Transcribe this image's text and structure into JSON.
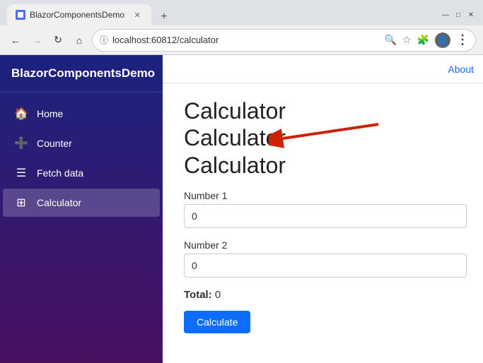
{
  "browser": {
    "tab_title": "BlazorComponentsDemo",
    "url": "localhost:60812/calculator",
    "new_tab_icon": "+",
    "window_controls": {
      "minimize": "—",
      "maximize": "□",
      "close": "✕"
    },
    "nav": {
      "back": "←",
      "forward": "→",
      "refresh": "↻",
      "home": "⌂",
      "search_icon": "🔍",
      "star_icon": "☆",
      "extensions_icon": "🧩",
      "profile_icon": "👤",
      "menu_icon": "⋮"
    }
  },
  "sidebar": {
    "brand": "BlazorComponentsDemo",
    "items": [
      {
        "id": "home",
        "label": "Home",
        "icon": "🏠"
      },
      {
        "id": "counter",
        "label": "Counter",
        "icon": "➕"
      },
      {
        "id": "fetch-data",
        "label": "Fetch data",
        "icon": "☰"
      },
      {
        "id": "calculator",
        "label": "Calculator",
        "icon": "⊞"
      }
    ]
  },
  "header": {
    "about_link": "About"
  },
  "main": {
    "page_title_1": "Calculator",
    "page_title_2": "Calculator",
    "page_title_3": "Calculator",
    "field1_label": "Number 1",
    "field1_value": "0",
    "field1_placeholder": "0",
    "field2_label": "Number 2",
    "field2_value": "0",
    "field2_placeholder": "0",
    "total_label": "Total:",
    "total_value": "0",
    "calculate_btn": "Calculate"
  }
}
